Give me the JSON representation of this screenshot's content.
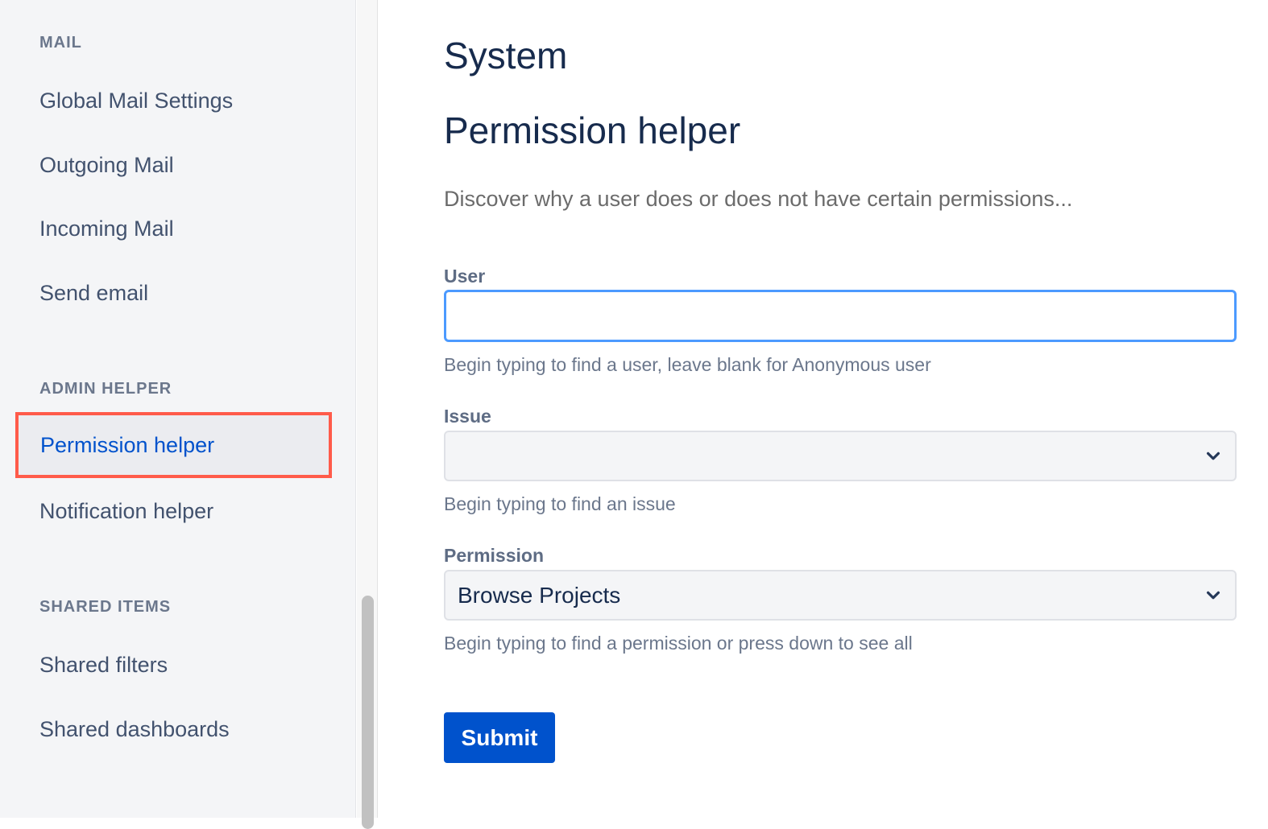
{
  "sidebar": {
    "sections": [
      {
        "heading": "MAIL",
        "items": [
          {
            "label": "Global Mail Settings"
          },
          {
            "label": "Outgoing Mail"
          },
          {
            "label": "Incoming Mail"
          },
          {
            "label": "Send email"
          }
        ]
      },
      {
        "heading": "ADMIN HELPER",
        "items": [
          {
            "label": "Permission helper",
            "active": true
          },
          {
            "label": "Notification helper"
          }
        ]
      },
      {
        "heading": "SHARED ITEMS",
        "items": [
          {
            "label": "Shared filters"
          },
          {
            "label": "Shared dashboards"
          }
        ]
      }
    ],
    "highlight_color": "#ff5b4a",
    "active_color": "#0052cc"
  },
  "main": {
    "page_title": "System",
    "sub_title": "Permission helper",
    "description": "Discover why a user does or does not have certain permissions...",
    "form": {
      "user": {
        "label": "User",
        "value": "",
        "placeholder": "",
        "help": "Begin typing to find a user, leave blank for Anonymous user"
      },
      "issue": {
        "label": "Issue",
        "value": "",
        "help": "Begin typing to find an issue"
      },
      "permission": {
        "label": "Permission",
        "value": "Browse Projects",
        "help": "Begin typing to find a permission or press down to see all"
      },
      "submit_label": "Submit"
    },
    "accent_color": "#0052cc",
    "focus_color": "#4c9aff"
  }
}
